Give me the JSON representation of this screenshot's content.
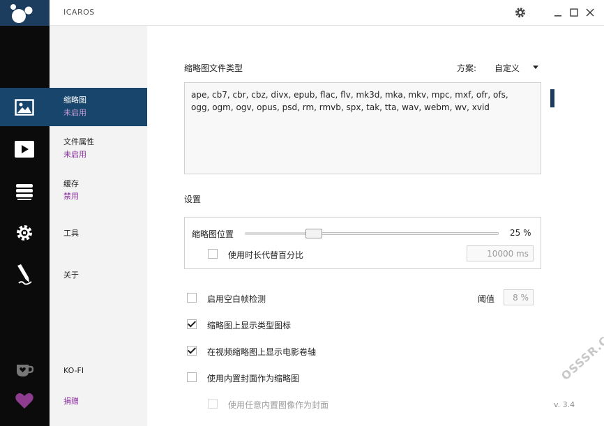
{
  "window": {
    "title": "ICAROS",
    "settings_icon": "gear-icon",
    "minimize_icon": "minimize-icon",
    "maximize_icon": "maximize-icon",
    "close_icon": "close-icon"
  },
  "rail": {
    "icons": [
      "image-icon",
      "play-icon",
      "stack-icon",
      "gear-icon",
      "pen-icon",
      "cup-icon",
      "heart-icon"
    ]
  },
  "nav": {
    "items": [
      {
        "label": "缩略图",
        "status": "未启用"
      },
      {
        "label": "文件属性",
        "status": "未启用"
      },
      {
        "label": "缓存",
        "status": "禁用"
      },
      {
        "label": "工具",
        "status": ""
      },
      {
        "label": "关于",
        "status": ""
      }
    ],
    "kofi": "KO-FI",
    "donate": "捐赠"
  },
  "content": {
    "filetypes_label": "缩略图文件类型",
    "scheme_label": "方案:",
    "scheme_value": "自定义",
    "filetypes_line1": "ape,  cb7,  cbr,  cbz,  divx,  epub,  flac,  flv,  mk3d,  mka,  mkv,  mpc,  mxf,  ofr,  ofs,",
    "filetypes_line2": "ogg,  ogm,  ogv,  opus,  psd,  rm,  rmvb,  spx,  tak,  tta,  wav,  webm,  wv,  xvid",
    "settings_label": "设置",
    "thumb_pos_label": "缩略图位置",
    "thumb_pos_value": "25 %",
    "thumb_pos_fraction": 0.25,
    "use_duration_label": "使用时长代替百分比",
    "use_duration_checked": false,
    "duration_value": "10000 ms",
    "blank_frame_label": "启用空白帧检测",
    "blank_frame_checked": false,
    "threshold_label": "阈值",
    "threshold_value": "8 %",
    "show_type_icon_label": "缩略图上显示类型图标",
    "show_type_icon_checked": true,
    "show_film_label": "在视频缩略图上显示电影卷轴",
    "show_film_checked": true,
    "use_cover_label": "使用内置封面作为缩略图",
    "use_cover_checked": false,
    "use_any_cover_label": "使用任意内置图像作为封面",
    "use_any_cover_checked": false,
    "version": "v. 3.4"
  },
  "watermark": "OSSSR.COM",
  "colors": {
    "accent": "#17456b",
    "status_purple": "#8a2f9c",
    "rail_bg": "#0b0b0b"
  }
}
